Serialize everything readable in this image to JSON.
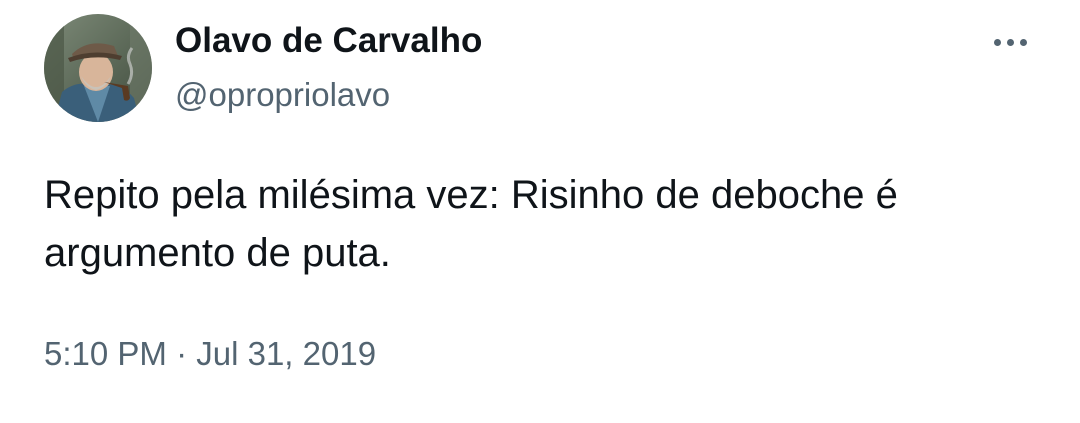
{
  "tweet": {
    "author": {
      "display_name": "Olavo de Carvalho",
      "handle": "@opropriolavo"
    },
    "text_line1": "Repito pela milésima vez: Risinho de deboche é",
    "text_line2": "argumento de puta.",
    "time": "5:10 PM",
    "separator": "·",
    "date": "Jul 31, 2019",
    "more_icon": "more-horizontal-icon"
  },
  "colors": {
    "primary_text": "#0f1419",
    "secondary_text": "#536471",
    "background": "#ffffff"
  }
}
